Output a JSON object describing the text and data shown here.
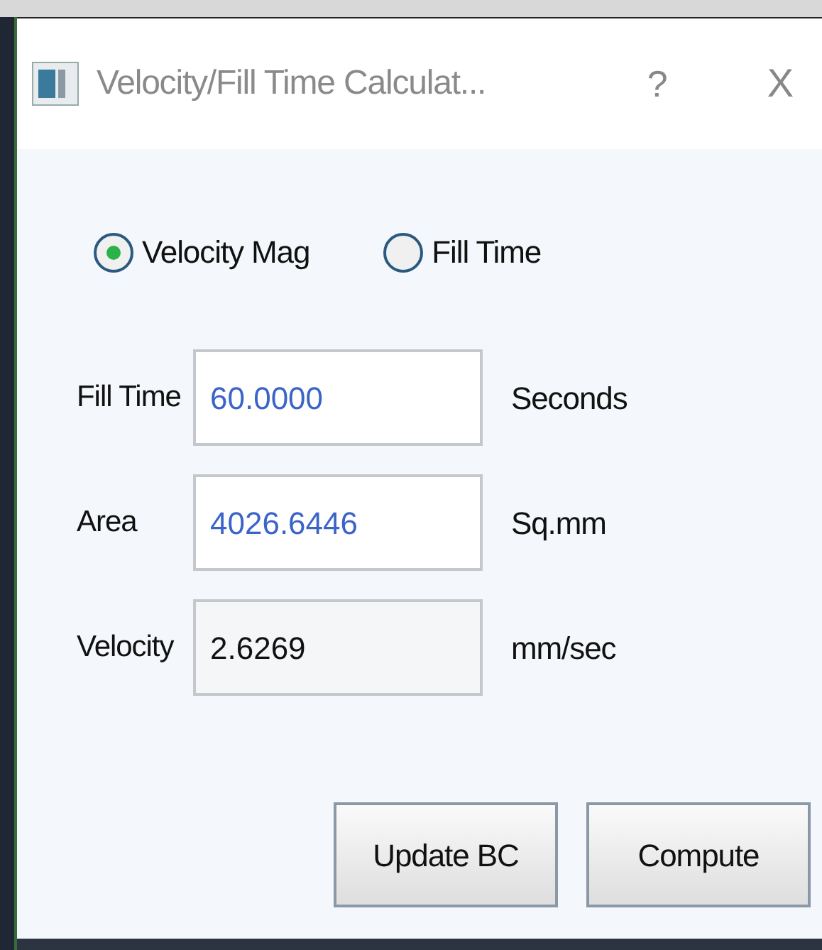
{
  "window": {
    "title": "Velocity/Fill Time Calculat...",
    "help": "?",
    "close": "X"
  },
  "modes": [
    {
      "label": "Velocity Mag",
      "selected": true
    },
    {
      "label": "Fill Time",
      "selected": false
    }
  ],
  "fields": [
    {
      "label": "Fill Time",
      "value": "60.0000",
      "unit": "Seconds",
      "editable": true
    },
    {
      "label": "Area",
      "value": "4026.6446",
      "unit": "Sq.mm",
      "editable": true
    },
    {
      "label": "Velocity",
      "value": "2.6269",
      "unit": "mm/sec",
      "editable": false
    }
  ],
  "buttons": [
    "Update BC",
    "Compute"
  ]
}
